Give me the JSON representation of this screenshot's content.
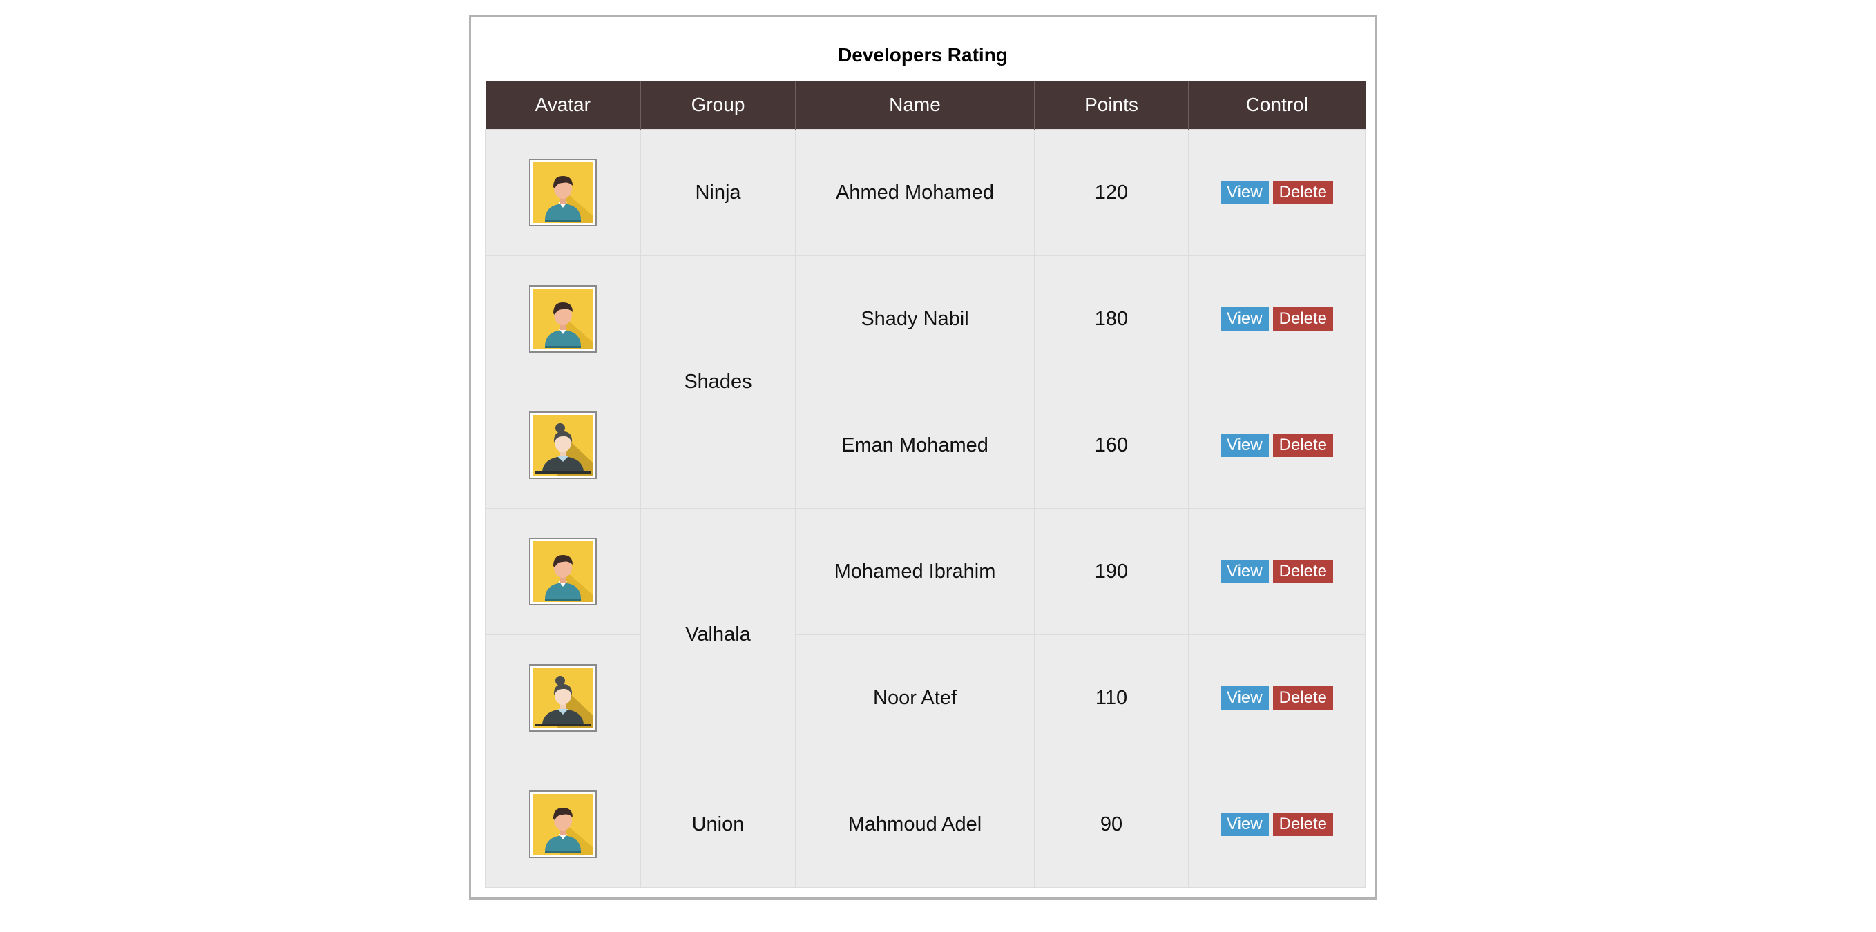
{
  "title": "Developers Rating",
  "columns": {
    "avatar": "Avatar",
    "group": "Group",
    "name": "Name",
    "points": "Points",
    "control": "Control"
  },
  "groups": [
    "Ninja",
    "Shades",
    "Valhala",
    "Union"
  ],
  "rows": [
    {
      "avatar": "male-avatar-icon",
      "name": "Ahmed Mohamed",
      "points": "120",
      "view_label": "View",
      "delete_label": "Delete"
    },
    {
      "avatar": "male-avatar-icon",
      "name": "Shady Nabil",
      "points": "180",
      "view_label": "View",
      "delete_label": "Delete"
    },
    {
      "avatar": "female-avatar-icon",
      "name": "Eman Mohamed",
      "points": "160",
      "view_label": "View",
      "delete_label": "Delete"
    },
    {
      "avatar": "male-avatar-icon",
      "name": "Mohamed Ibrahim",
      "points": "190",
      "view_label": "View",
      "delete_label": "Delete"
    },
    {
      "avatar": "female-avatar-icon",
      "name": "Noor Atef",
      "points": "110",
      "view_label": "View",
      "delete_label": "Delete"
    },
    {
      "avatar": "male-avatar-icon",
      "name": "Mahmoud Adel",
      "points": "90",
      "view_label": "View",
      "delete_label": "Delete"
    }
  ],
  "colors": {
    "header_bg": "#463636",
    "row_bg": "#ececec",
    "view_button": "#4499cf",
    "delete_button": "#b2413c",
    "avatar_bg": "#f4c83f"
  }
}
